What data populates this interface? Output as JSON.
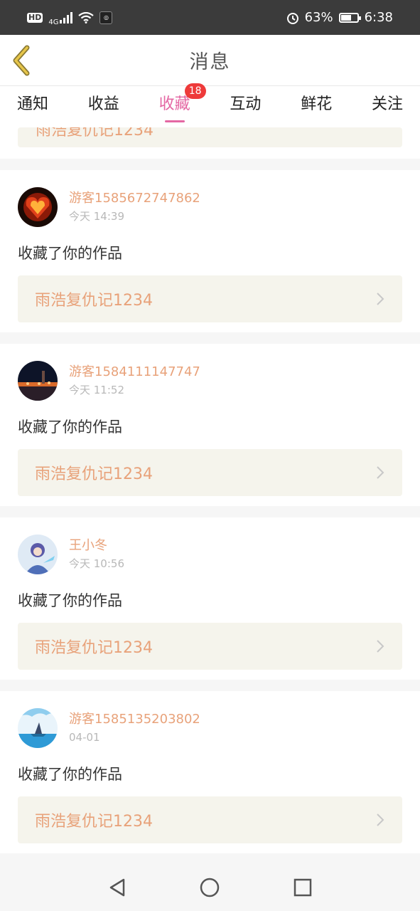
{
  "status_bar": {
    "hd": "HD",
    "network": "4G",
    "battery_percent": "63%",
    "time": "6:38"
  },
  "header": {
    "title": "消息"
  },
  "tabs": [
    {
      "label": "通知"
    },
    {
      "label": "收益"
    },
    {
      "label": "收藏",
      "badge": "18",
      "active": true
    },
    {
      "label": "互动"
    },
    {
      "label": "鲜花"
    },
    {
      "label": "关注"
    }
  ],
  "partial_card": {
    "work_title": "雨浩复仇记1234"
  },
  "items": [
    {
      "user": "游客1585672747862",
      "time": "今天 14:39",
      "action": "收藏了你的作品",
      "work": "雨浩复仇记1234"
    },
    {
      "user": "游客1584111147747",
      "time": "今天 11:52",
      "action": "收藏了你的作品",
      "work": "雨浩复仇记1234"
    },
    {
      "user": "王小冬",
      "time": "今天 10:56",
      "action": "收藏了你的作品",
      "work": "雨浩复仇记1234"
    },
    {
      "user": "游客1585135203802",
      "time": "04-01",
      "action": "收藏了你的作品",
      "work": "雨浩复仇记1234"
    }
  ],
  "colors": {
    "accent": "#e467a3",
    "badge": "#ee3a3a",
    "username": "#e8a27a",
    "work_box_bg": "#f5f4ec"
  },
  "icons": [
    "back-arrow-icon",
    "alarm-icon",
    "wifi-icon",
    "signal-icon",
    "battery-icon",
    "chevron-right-icon",
    "nav-back-icon",
    "nav-home-icon",
    "nav-recent-icon"
  ]
}
